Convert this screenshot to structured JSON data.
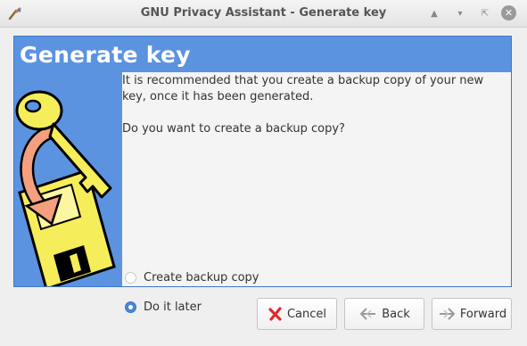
{
  "window": {
    "title": "GNU Privacy Assistant - Generate key",
    "controls": [
      "shade-icon",
      "minimize-icon",
      "restore-icon",
      "close-icon"
    ]
  },
  "page": {
    "heading": "Generate key",
    "message_line1": "It is recommended that you create a backup copy of your new key, once it has been generated.",
    "question": "Do you want to create a backup copy?",
    "options": [
      {
        "label": "Create backup copy",
        "selected": false
      },
      {
        "label": "Do it later",
        "selected": true
      }
    ]
  },
  "buttons": {
    "cancel": "Cancel",
    "back": "Back",
    "forward": "Forward"
  },
  "colors": {
    "header_blue": "#5c93e1",
    "key_yellow": "#f5ee5a",
    "arrow_salmon": "#f4a07f",
    "selected_radio": "#4a86d6"
  },
  "icons": {
    "app": "gpa-app-icon",
    "artwork": "key-floppy-illustration",
    "cancel": "red-x-icon",
    "back": "back-arrow-icon",
    "forward": "forward-arrow-icon"
  }
}
